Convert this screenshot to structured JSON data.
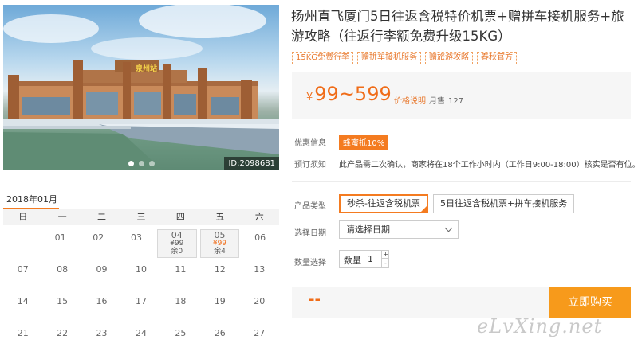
{
  "gallery": {
    "photo_id": "ID:2098681",
    "building_sign": "泉州站",
    "dots": 3,
    "active_dot": 0
  },
  "product": {
    "title": "扬州直飞厦门5日往返含税特价机票+赠拼车接机服务+旅游攻略（往返行李额免费升级15KG）",
    "tags": [
      "15KG免费行李",
      "赠拼车接机服务",
      "赠旅游攻略",
      "春秋官方"
    ]
  },
  "price": {
    "currency": "¥",
    "range": "99~599",
    "note": "价格说明",
    "sales_label": "月售",
    "sales_count": "127"
  },
  "promo": {
    "label": "优惠信息",
    "badge": "蜂蜜抵10%"
  },
  "notice": {
    "label": "预订须知",
    "text": "此产品需二次确认，商家将在18个工作小时内（工作日9:00-18:00）核实是否有位。"
  },
  "product_type": {
    "label": "产品类型",
    "options": [
      "秒杀-往返含税机票",
      "5日往返含税机票+拼车接机服务"
    ],
    "selected": 0
  },
  "date": {
    "label": "选择日期",
    "placeholder": "请选择日期"
  },
  "quantity": {
    "label": "数量选择",
    "field_label": "数量",
    "value": "1",
    "plus": "+",
    "minus": "-"
  },
  "checkout": {
    "total": "--",
    "buy_label": "立即购买"
  },
  "watermark": "eLvXing.net",
  "calendar": {
    "month": "2018年01月",
    "weekdays": [
      "日",
      "一",
      "二",
      "三",
      "四",
      "五",
      "六"
    ],
    "weeks": [
      [
        null,
        {
          "day": "01"
        },
        {
          "day": "02"
        },
        {
          "day": "03"
        },
        {
          "day": "04",
          "price": "¥99",
          "stock": "余0"
        },
        {
          "day": "05",
          "price": "¥99",
          "stock": "余4",
          "highlight": true
        },
        {
          "day": "06"
        }
      ],
      [
        {
          "day": "07"
        },
        {
          "day": "08"
        },
        {
          "day": "09"
        },
        {
          "day": "10"
        },
        {
          "day": "11"
        },
        {
          "day": "12"
        },
        {
          "day": "13"
        }
      ],
      [
        {
          "day": "14"
        },
        {
          "day": "15"
        },
        {
          "day": "16"
        },
        {
          "day": "17"
        },
        {
          "day": "18"
        },
        {
          "day": "19"
        },
        {
          "day": "20"
        }
      ],
      [
        {
          "day": "21"
        },
        {
          "day": "22"
        },
        {
          "day": "23"
        },
        {
          "day": "24"
        },
        {
          "day": "25"
        },
        {
          "day": "26"
        },
        {
          "day": "27"
        }
      ]
    ]
  },
  "colors": {
    "accent": "#f47b20",
    "price": "#f06c18",
    "buy_button": "#f79a1b"
  }
}
